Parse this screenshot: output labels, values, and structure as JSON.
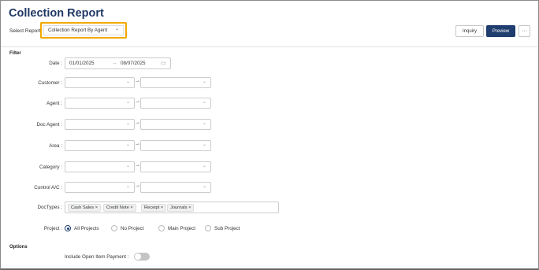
{
  "page": {
    "title": "Collection Report"
  },
  "report": {
    "select_label": "Select Report",
    "selected": "Collection Report By Agent"
  },
  "toolbar": {
    "inquiry": "Inquiry",
    "preview": "Preview",
    "more": "···"
  },
  "filter": {
    "heading": "Filter",
    "date_label": "Date :",
    "date_from": "01/01/2025",
    "date_to": "08/07/2025",
    "date_arrow": "→",
    "ranges": [
      {
        "label": "Customer :"
      },
      {
        "label": "Agent :"
      },
      {
        "label": "Doc Agent :"
      },
      {
        "label": "Area :"
      },
      {
        "label": "Category :"
      },
      {
        "label": "Control A/C :"
      }
    ],
    "doctypes_label": "DocTypes :",
    "doctypes": [
      "Cash Sales",
      "Credit Note",
      "Receipt",
      "Journals"
    ],
    "project_label": "Project :",
    "project_options": [
      "All Projects",
      "No Project",
      "Main Project",
      "Sub Project"
    ],
    "project_selected": "All Projects"
  },
  "options": {
    "heading": "Options",
    "open_item_label": "Include Open Item Payment :",
    "open_item_enabled": false
  },
  "icons": {
    "chevron": "chevron-down-icon",
    "calendar": "calendar-icon",
    "arrow": "range-arrow-icon",
    "close": "tag-remove-icon"
  },
  "colors": {
    "title": "#1f3864",
    "primary": "#1f3d6e",
    "highlight": "#f2a900"
  }
}
